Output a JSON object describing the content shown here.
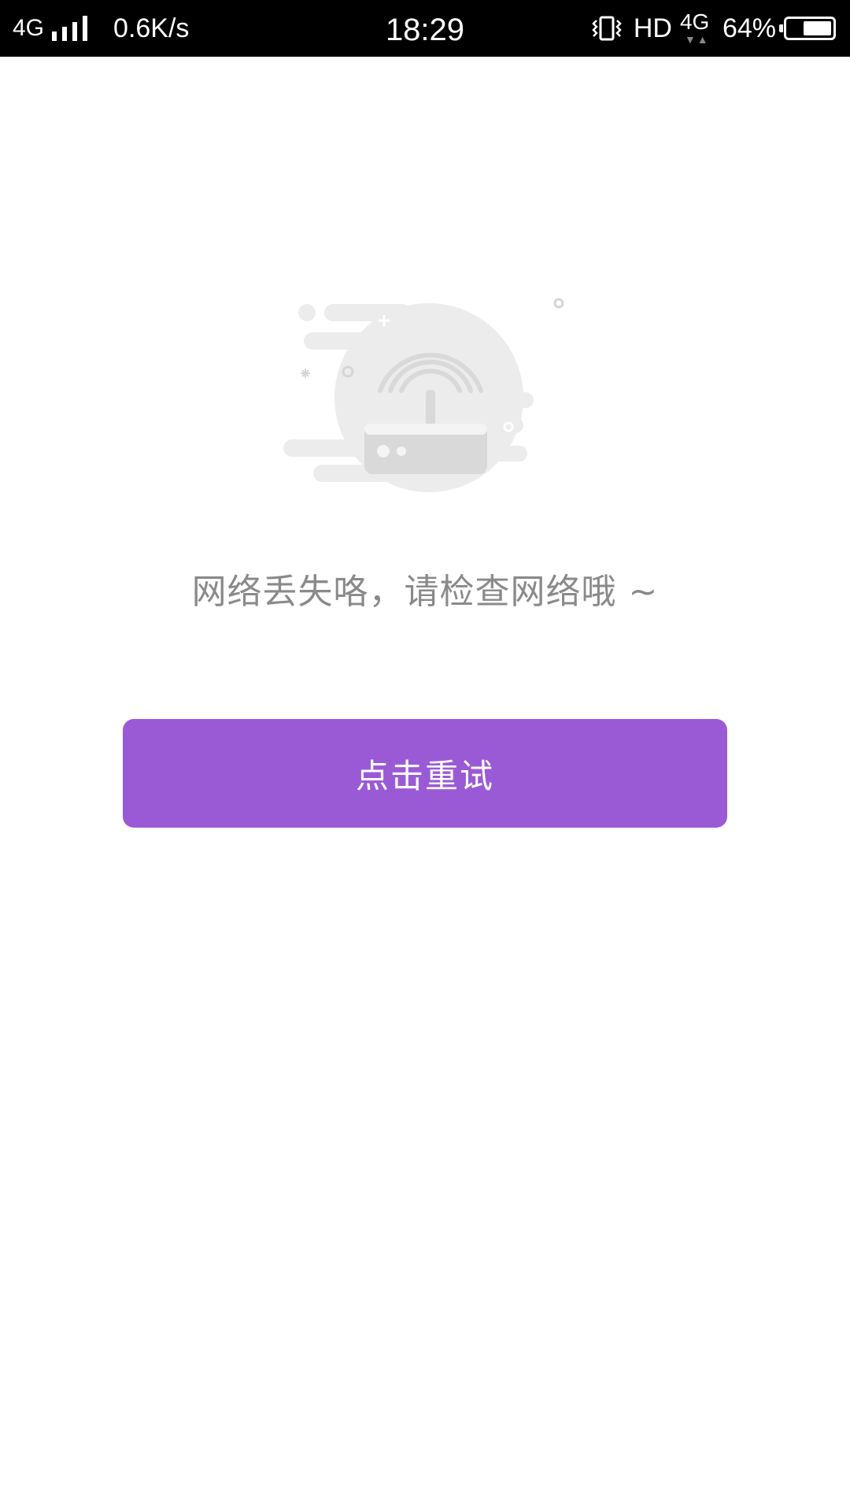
{
  "status_bar": {
    "network_type": "4G",
    "net_speed": "0.6K/s",
    "time": "18:29",
    "hd_label": "HD",
    "data_type": "4G",
    "battery_percent_text": "64%",
    "battery_level": 0.64,
    "icons": [
      "signal-icon",
      "vibrate-icon",
      "data-activity-icon",
      "battery-icon"
    ]
  },
  "empty_state": {
    "illustration": "router-offline-icon",
    "message": "网络丢失咯，请检查网络哦 ~"
  },
  "actions": {
    "retry_label": "点击重试"
  },
  "colors": {
    "status_bar_bg": "#000000",
    "background": "#ffffff",
    "button_bg": "#9b5ad5",
    "button_text": "#ffffff",
    "message_text": "#8a8a8a",
    "illustration_gray": "#ececec"
  }
}
